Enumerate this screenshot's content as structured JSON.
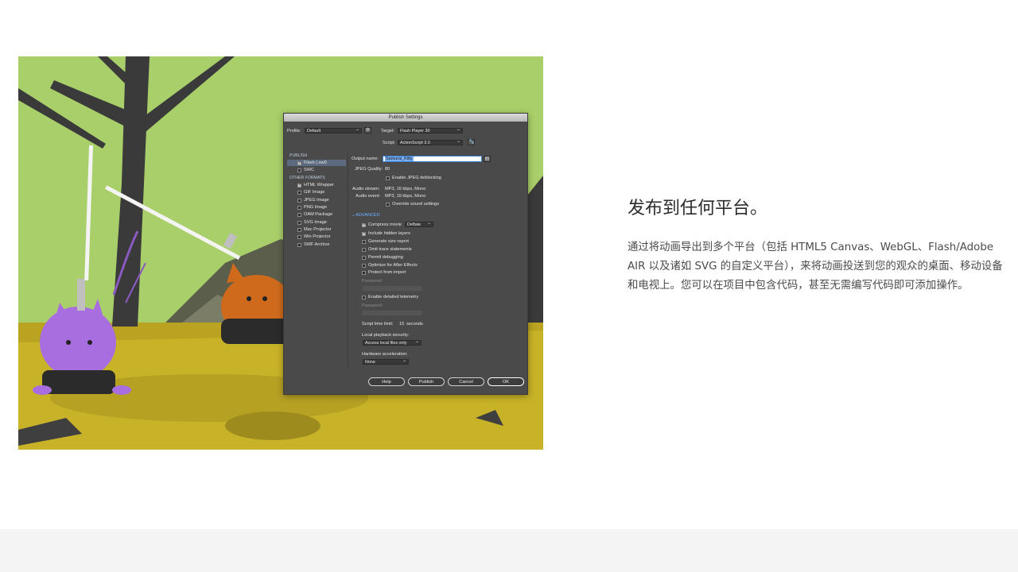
{
  "headline": "发布到任何平台。",
  "description": "通过将动画导出到多个平台（包括 HTML5 Canvas、WebGL、Flash/Adobe AIR 以及诸如 SVG 的自定义平台），来将动画投送到您的观众的桌面、移动设备和电视上。您可以在项目中包含代码，甚至无需编写代码即可添加操作。",
  "colors": {
    "sky": "#a9cf6a",
    "ground": "#c8b227",
    "dialog_bg": "#4a4a4a",
    "purple_cat": "#a86ee0",
    "orange_cat": "#cf6a1c",
    "footer": "#f4f4f4"
  },
  "dialog": {
    "title": "Publish Settings",
    "profile_label": "Profile:",
    "profile_value": "Default",
    "target_label": "Target:",
    "target_value": "Flash Player 30",
    "script_label": "Script:",
    "script_value": "ActionScript 3.0",
    "publish_header": "PUBLISH",
    "publish_items": [
      {
        "label": "Flash (.swf)",
        "checked": true
      },
      {
        "label": "SWC",
        "checked": false
      }
    ],
    "other_header": "OTHER FORMATS",
    "other_items": [
      {
        "label": "HTML Wrapper",
        "checked": true
      },
      {
        "label": "GIF Image",
        "checked": false
      },
      {
        "label": "JPEG Image",
        "checked": false
      },
      {
        "label": "PNG Image",
        "checked": false
      },
      {
        "label": "OAM Package",
        "checked": false
      },
      {
        "label": "SVG Image",
        "checked": false
      },
      {
        "label": "Mac Projector",
        "checked": false
      },
      {
        "label": "Win Projector",
        "checked": false
      },
      {
        "label": "SWF Archive",
        "checked": false
      }
    ],
    "output_name_label": "Output name:",
    "output_name_value": "Samurai_Kitty",
    "jpeg_quality_label": "JPEG Quality:",
    "jpeg_quality_value": "80",
    "jpeg_deblocking": "Enable JPEG deblocking",
    "audio_stream_label": "Audio stream:",
    "audio_stream_value": "MP3, 16 kbps, Mono",
    "audio_event_label": "Audio event:",
    "audio_event_value": "MP3, 16 kbps, Mono",
    "override_sound": "Override sound settings",
    "advanced_label": "ADVANCED",
    "advanced_items": [
      {
        "label": "Compress movie",
        "checked": true
      },
      {
        "label": "Include hidden layers",
        "checked": true
      },
      {
        "label": "Generate size report",
        "checked": false
      },
      {
        "label": "Omit trace statements",
        "checked": false
      },
      {
        "label": "Permit debugging",
        "checked": false
      },
      {
        "label": "Optimize for After Effects",
        "checked": false
      },
      {
        "label": "Protect from import",
        "checked": false
      }
    ],
    "compress_value": "Deflate",
    "password_label": "Password:",
    "telemetry": "Enable detailed telemetry",
    "script_time_label": "Script time limit:",
    "script_time_value": "15",
    "script_time_unit": "seconds",
    "local_playback_label": "Local playback security:",
    "local_playback_value": "Access local files only",
    "hw_accel_label": "Hardware acceleration:",
    "hw_accel_value": "None",
    "buttons": {
      "help": "Help",
      "publish": "Publish",
      "cancel": "Cancel",
      "ok": "OK"
    }
  }
}
